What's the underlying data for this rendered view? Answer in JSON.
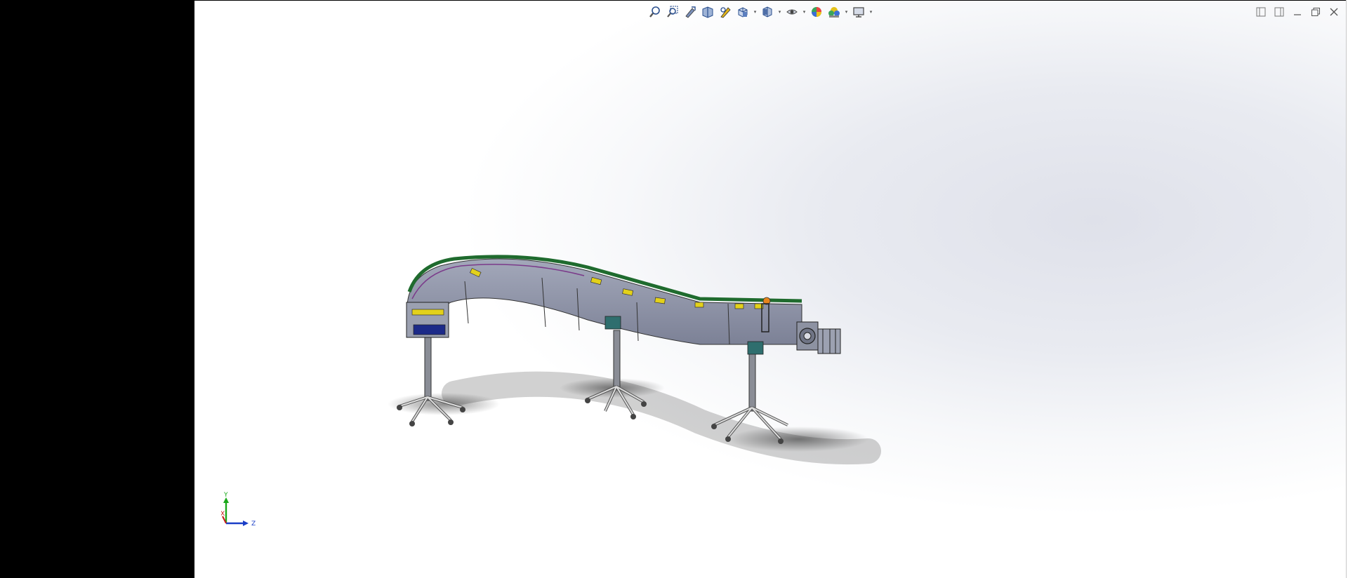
{
  "heads_up_toolbar": {
    "items": [
      {
        "name": "zoom-to-fit-icon"
      },
      {
        "name": "zoom-to-area-icon"
      },
      {
        "name": "previous-view-icon"
      },
      {
        "name": "section-view-icon"
      },
      {
        "name": "dynamic-annotation-icon"
      },
      {
        "name": "view-orientation-icon",
        "has_dropdown": true
      },
      {
        "name": "display-style-icon",
        "has_dropdown": true
      },
      {
        "name": "hide-show-items-icon",
        "has_dropdown": true
      },
      {
        "name": "edit-appearance-icon"
      },
      {
        "name": "apply-scene-icon",
        "has_dropdown": true
      },
      {
        "name": "view-settings-icon",
        "has_dropdown": true
      }
    ]
  },
  "window_controls": [
    "tile-left-icon",
    "tile-right-icon",
    "minimize-icon",
    "restore-icon",
    "close-icon"
  ],
  "triad": {
    "y_label": "Y",
    "x_label": "X",
    "z_label": "Z"
  },
  "colors": {
    "belt_green": "#1f6b2e",
    "frame_gray": "#8e93a6",
    "bracket_yellow": "#e3d11a",
    "motor_teal": "#2f6e6e",
    "accent_orange": "#e8851b"
  }
}
